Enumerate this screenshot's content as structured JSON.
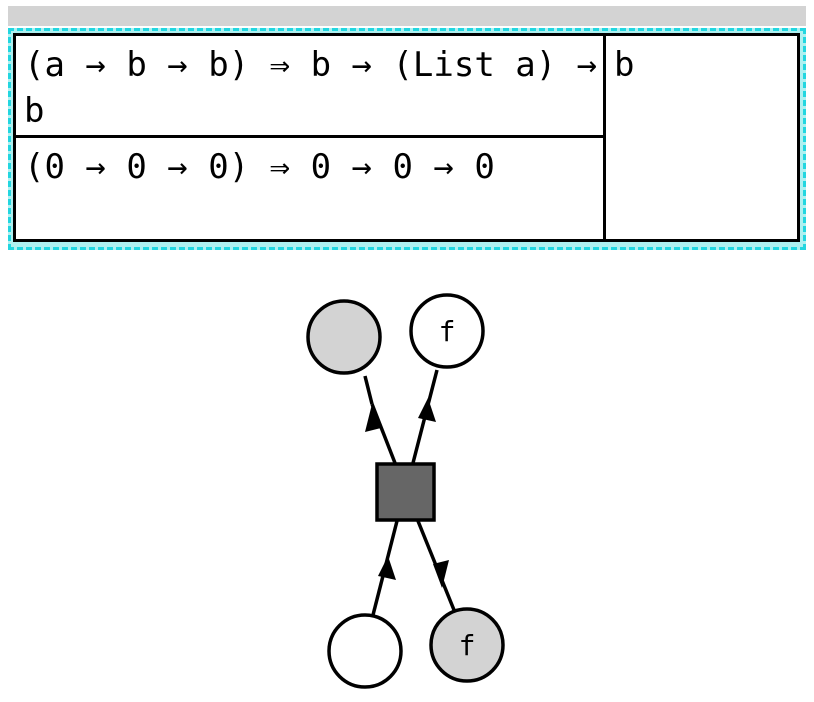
{
  "signature": {
    "type": "(a → b → b) ⇒ b → (List a) → b",
    "instance": "(0 → 0 → 0) ⇒ 0 → 0 → 0",
    "result": "b"
  },
  "graph": {
    "nodes": [
      {
        "id": "top-left",
        "label": "",
        "fill": "#d3d3d3"
      },
      {
        "id": "top-right",
        "label": "f",
        "fill": "#ffffff"
      },
      {
        "id": "bottom-left",
        "label": "",
        "fill": "#ffffff"
      },
      {
        "id": "bottom-right",
        "label": "f",
        "fill": "#d3d3d3"
      },
      {
        "id": "center",
        "label": "",
        "fill": "#666666"
      }
    ]
  },
  "colors": {
    "panel_border": "#22d6e0",
    "panel_bg": "#aef0f0",
    "top_bar": "#d3d3d3",
    "node_dark": "#666666"
  }
}
